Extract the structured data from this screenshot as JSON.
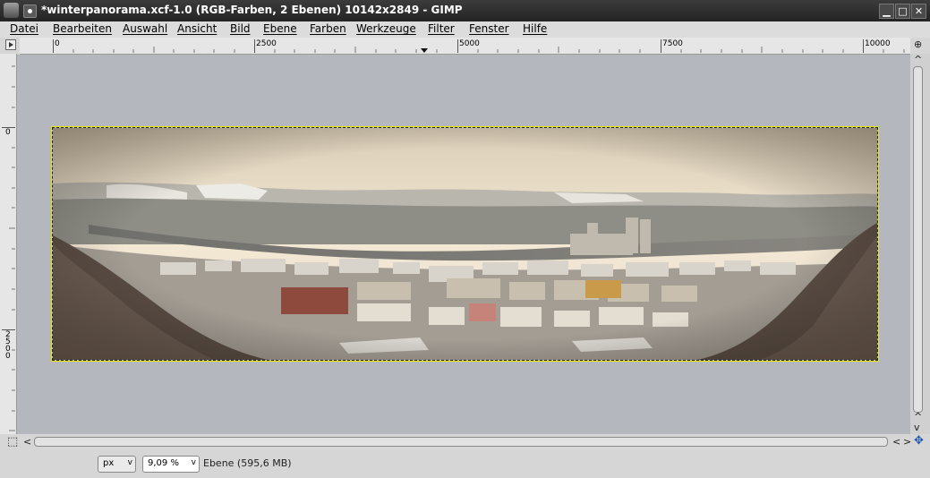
{
  "window": {
    "title": "*winterpanorama.xcf-1.0 (RGB-Farben, 2 Ebenen) 10142x2849 - GIMP",
    "minimize_glyph": "▁",
    "maximize_glyph": "□",
    "close_glyph": "✕"
  },
  "menu": [
    "Datei",
    "Bearbeiten",
    "Auswahl",
    "Ansicht",
    "Bild",
    "Ebene",
    "Farben",
    "Werkzeuge",
    "Filter",
    "Fenster",
    "Hilfe"
  ],
  "ruler": {
    "horizontal_labels": [
      "0",
      "2500",
      "5000",
      "7500",
      "10000"
    ],
    "vertical_labels": [
      "0",
      "2500"
    ]
  },
  "status": {
    "unit": "px",
    "zoom": "9,09 %",
    "layer_info": "Ebene (595,6 MB)"
  },
  "icons": {
    "vscroll_up": "^",
    "vscroll_down": "v",
    "hscroll_left": "<",
    "hscroll_right": ">",
    "navigate": "✥",
    "quickmask": "⬚",
    "zoom": "⊕",
    "dropdown": "v"
  },
  "colors": {
    "canvas_background": "#b4b8be",
    "titlebar": "#2e2e2e",
    "selection_marching_ants": "#e6e600"
  }
}
